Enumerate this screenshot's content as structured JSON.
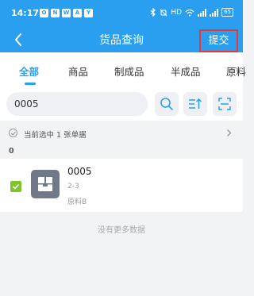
{
  "status_bar": {
    "time": "14:17",
    "app_icons": [
      "O",
      "N",
      "W",
      "A",
      "Y"
    ],
    "signal_text": "HD",
    "battery": "65"
  },
  "nav": {
    "title": "货品查询",
    "submit_label": "提交"
  },
  "tabs": [
    {
      "label": "全部",
      "active": true
    },
    {
      "label": "商品",
      "active": false
    },
    {
      "label": "制成品",
      "active": false
    },
    {
      "label": "半成品",
      "active": false
    },
    {
      "label": "原料",
      "active": false
    }
  ],
  "search": {
    "value": "0005"
  },
  "selection": {
    "text": "当前选中 1 张单据"
  },
  "group": {
    "label": "0"
  },
  "items": [
    {
      "code": "0005",
      "spec": "2-3",
      "category": "原料B",
      "checked": true
    }
  ],
  "footer": {
    "no_more": "没有更多数据"
  },
  "colors": {
    "primary": "#2a9ff0",
    "highlight_border": "#e53935",
    "check_green": "#7ec42a"
  }
}
